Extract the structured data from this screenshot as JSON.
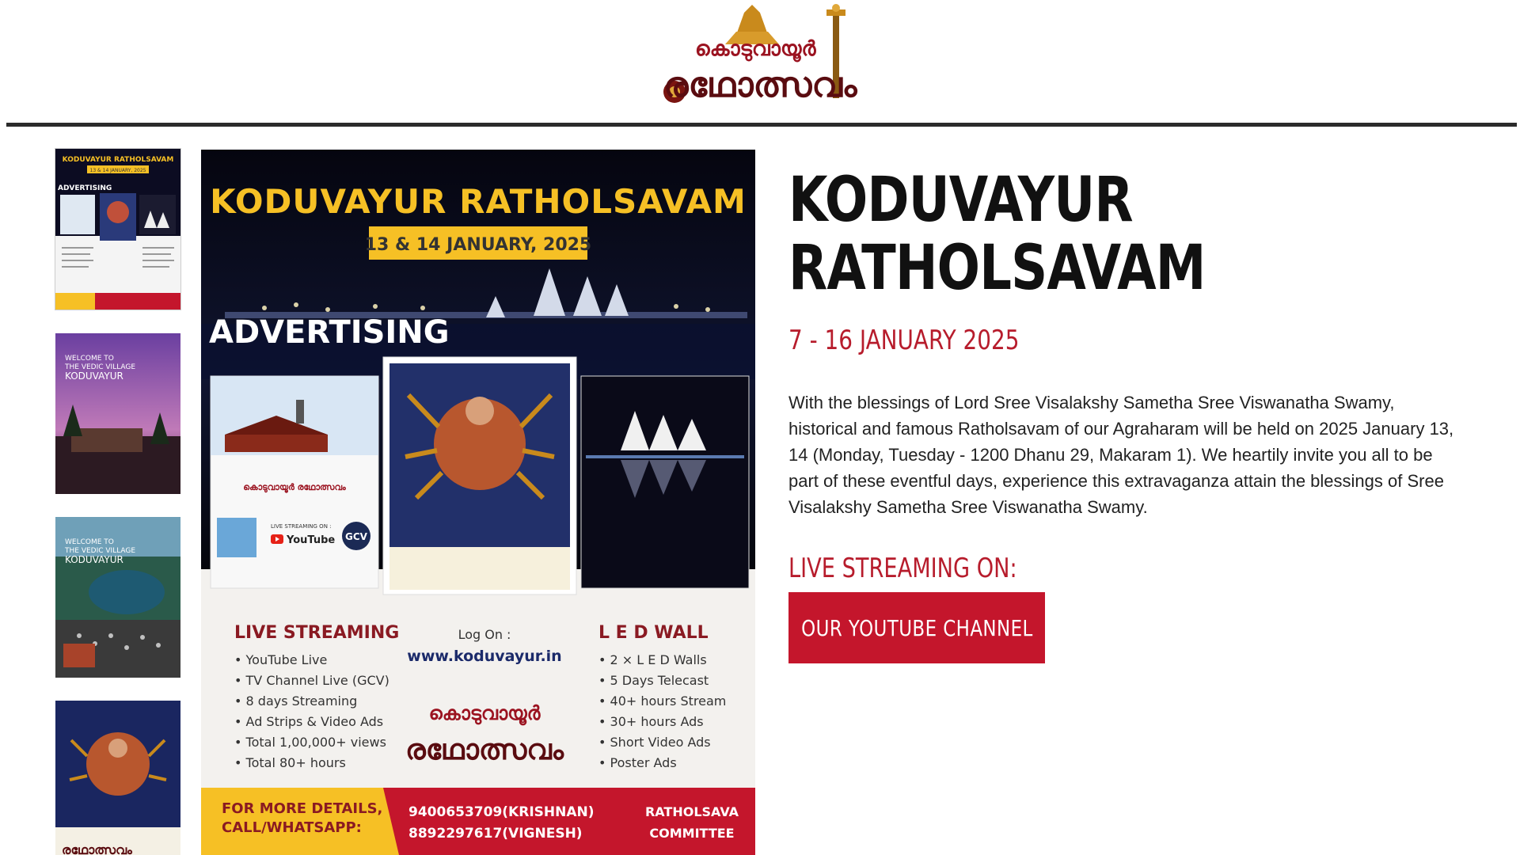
{
  "header": {
    "logo_text_line1": "കൊടുവായൂർ",
    "logo_text_line2": "രഥോത്സവം"
  },
  "thumbnails": [
    {
      "title": "KODUVAYUR RATHOLSAVAM",
      "date": "13 & 14 JANUARY, 2025",
      "tag": "ADVERTISING"
    },
    {
      "welcome": "WELCOME TO",
      "village": "THE VEDIC VILLAGE",
      "place": "KODUVAYUR"
    },
    {
      "welcome": "WELCOME TO",
      "village": "THE VEDIC VILLAGE",
      "place": "KODUVAYUR"
    },
    {
      "caption": "രഥോത്സവം"
    }
  ],
  "poster": {
    "title": "KODUVAYUR RATHOLSAVAM",
    "date": "13 & 14 JANUARY, 2025",
    "tag": "ADVERTISING",
    "left_card": {
      "caption": "കൊടുവായൂർ രഥോത്സവം",
      "streaming_on": "LIVE STREAMING ON :",
      "youtube": "YouTube",
      "gcv": "GCV"
    },
    "live_heading": "LIVE STREAMING",
    "live_items": [
      "YouTube Live",
      "TV Channel Live (GCV)",
      "8 days Streaming",
      "Ad Strips & Video Ads",
      "Total 1,00,000+ views",
      "Total 80+ hours"
    ],
    "logon_label": "Log On :",
    "logon_url": "www.koduvayur.in",
    "center_logo_1": "കൊടുവായൂർ",
    "center_logo_2": "രഥോത്സവം",
    "led_heading": "L E D  WALL",
    "led_items": [
      "2 × L E D Walls",
      "5 Days Telecast",
      "40+ hours Stream",
      "30+ hours Ads",
      "Short Video Ads",
      "Poster Ads"
    ],
    "footer_left_1": "FOR MORE DETAILS,",
    "footer_left_2": "CALL/WHATSAPP:",
    "phone_1": "9400653709(KRISHNAN)",
    "phone_2": "8892297617(VIGNESH)",
    "committee_1": "RATHOLSAVA",
    "committee_2": "COMMITTEE"
  },
  "info": {
    "title": "KODUVAYUR RATHOLSAVAM",
    "dates": "7 - 16 JANUARY 2025",
    "description": "With the blessings of Lord Sree Visalakshy Sametha Sree Viswanatha Swamy, historical and famous Ratholsavam of our Agraharam will be held on 2025 January 13, 14 (Monday, Tuesday - 1200 Dhanu 29, Makaram 1). We heartily invite you all to be part of these eventful days, experience this extravaganza attain the blessings of Sree Visalakshy Sametha Sree Viswanatha Swamy.",
    "live_label": "LIVE STREAMING ON:",
    "youtube_button": "OUR YOUTUBE CHANNEL"
  },
  "colors": {
    "accent_red": "#c4162c",
    "title_text": "#111111",
    "poster_yellow": "#f6c025",
    "poster_dark": "#0b0b1a"
  }
}
